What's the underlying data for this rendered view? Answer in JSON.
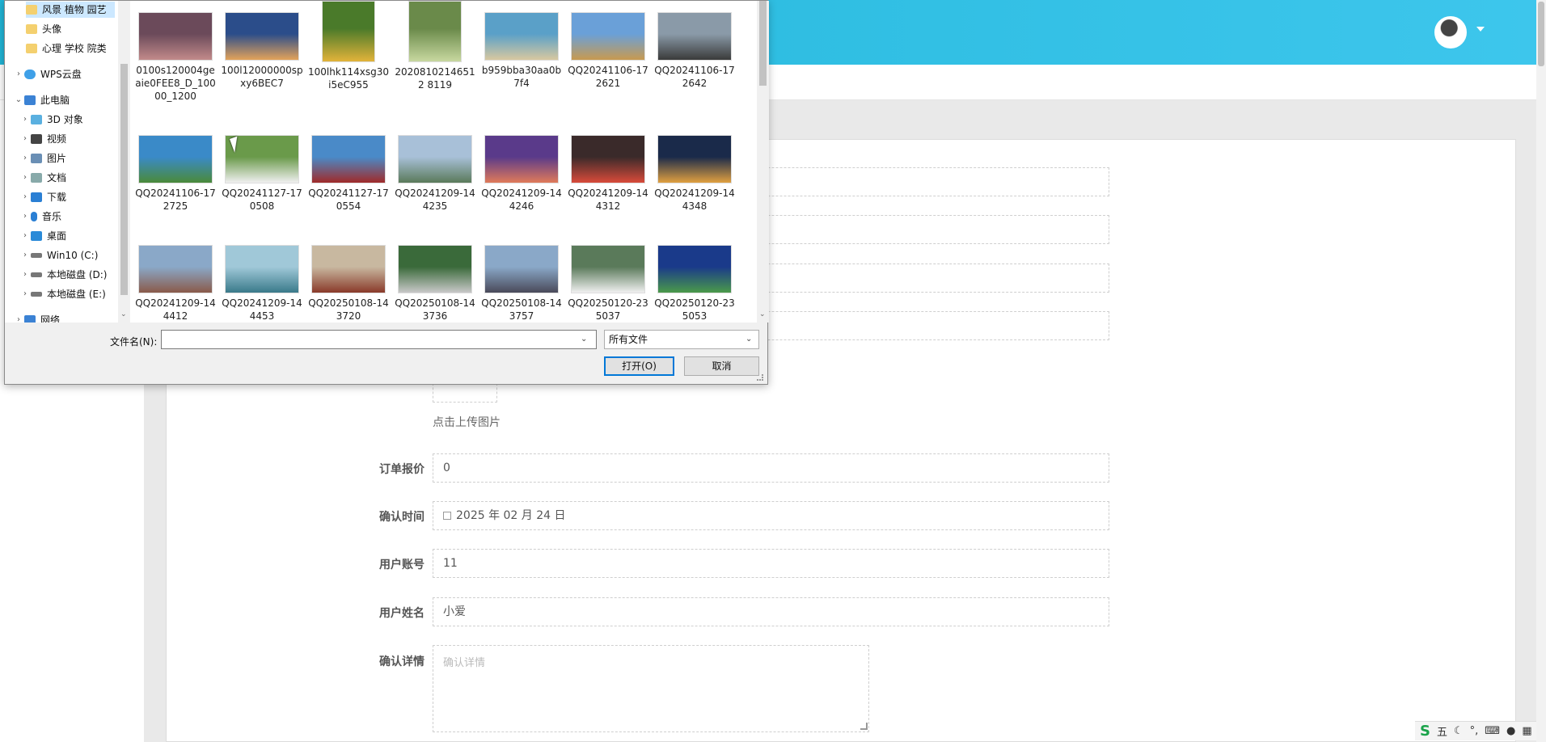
{
  "dialog": {
    "nav_items": [
      {
        "label": "风景 植物 园艺",
        "icon": "folder-icon",
        "selected": true
      },
      {
        "label": "头像",
        "icon": "folder-icon"
      },
      {
        "label": "心理 学校 院类",
        "icon": "folder-icon"
      },
      {
        "label": "WPS云盘",
        "icon": "cloud-icon"
      },
      {
        "label": "此电脑",
        "icon": "computer-icon",
        "expanded": true
      },
      {
        "label": "3D 对象",
        "icon": "cube-icon"
      },
      {
        "label": "视频",
        "icon": "video-icon"
      },
      {
        "label": "图片",
        "icon": "pictures-icon"
      },
      {
        "label": "文档",
        "icon": "documents-icon"
      },
      {
        "label": "下载",
        "icon": "download-icon"
      },
      {
        "label": "音乐",
        "icon": "music-icon"
      },
      {
        "label": "桌面",
        "icon": "desktop-icon"
      },
      {
        "label": "Win10 (C:)",
        "icon": "drive-icon"
      },
      {
        "label": "本地磁盘 (D:)",
        "icon": "drive-icon"
      },
      {
        "label": "本地磁盘 (E:)",
        "icon": "drive-icon"
      },
      {
        "label": "网络",
        "icon": "network-icon"
      }
    ],
    "files": [
      {
        "name": "0100s120004geaie0FEE8_D_10000_1200",
        "colors": [
          "#6b4a5a",
          "#c28a8a"
        ]
      },
      {
        "name": "100l12000000spxy6BEC7",
        "colors": [
          "#2b4d8a",
          "#e3a35a"
        ]
      },
      {
        "name": "100lhk114xsg30i5eC955",
        "colors": [
          "#4a7a2a",
          "#e2b33a"
        ],
        "tall": true
      },
      {
        "name": "20208102146512 8119",
        "colors": [
          "#6a8a4a",
          "#c8d8a0"
        ],
        "tall": true
      },
      {
        "name": "b959bba30aa0b7f4",
        "colors": [
          "#5aa0c8",
          "#d8c8a0"
        ]
      },
      {
        "name": "QQ20241106-172621",
        "colors": [
          "#6aa0d8",
          "#c89a50"
        ]
      },
      {
        "name": "QQ20241106-172642",
        "colors": [
          "#8a9aa8",
          "#3a3a3a"
        ]
      },
      {
        "name": "QQ20241106-172725",
        "colors": [
          "#3a8ac8",
          "#4a8a3a"
        ]
      },
      {
        "name": "QQ20241127-170508",
        "colors": [
          "#6a9a4a",
          "#f0f0f0"
        ]
      },
      {
        "name": "QQ20241127-170554",
        "colors": [
          "#4a8ac8",
          "#a02a2a"
        ]
      },
      {
        "name": "QQ20241209-144235",
        "colors": [
          "#a8c0d8",
          "#5a7a5a"
        ]
      },
      {
        "name": "QQ20241209-144246",
        "colors": [
          "#5a3a8a",
          "#e07a5a"
        ]
      },
      {
        "name": "QQ20241209-144312",
        "colors": [
          "#3a2a2a",
          "#d84a3a"
        ]
      },
      {
        "name": "QQ20241209-144348",
        "colors": [
          "#1a2a4a",
          "#e0a040"
        ]
      },
      {
        "name": "QQ20241209-144412",
        "colors": [
          "#8aa8c8",
          "#8a5a4a"
        ]
      },
      {
        "name": "QQ20241209-144453",
        "colors": [
          "#a0c8d8",
          "#3a7a8a"
        ]
      },
      {
        "name": "QQ20250108-143720",
        "colors": [
          "#c8b8a0",
          "#8a3a2a"
        ]
      },
      {
        "name": "QQ20250108-143736",
        "colors": [
          "#3a6a3a",
          "#c8c8c8"
        ]
      },
      {
        "name": "QQ20250108-143757",
        "colors": [
          "#8aa8c8",
          "#4a4a5a"
        ]
      },
      {
        "name": "QQ20250120-235037",
        "colors": [
          "#5a7a5a",
          "#f0f0f0"
        ]
      },
      {
        "name": "QQ20250120-235053",
        "colors": [
          "#1a3a8a",
          "#4a9a4a"
        ]
      }
    ],
    "filename_label": "文件名(N):",
    "filename_value": "",
    "filter_value": "所有文件",
    "open_label": "打开(O)",
    "cancel_label": "取消"
  },
  "form": {
    "upload_hint": "点击上传图片",
    "fields": [
      {
        "label": "订单报价",
        "value": "0",
        "top": 0
      },
      {
        "label": "确认时间",
        "value": "2025 年 02 月 24 日",
        "calendar": true
      },
      {
        "label": "用户账号",
        "value": "11"
      },
      {
        "label": "用户姓名",
        "value": "小爱"
      }
    ],
    "details_label": "确认详情",
    "details_placeholder": "确认详情"
  },
  "tray": {
    "ime_mode": "五"
  },
  "colors": {
    "header": "#2ebde3",
    "accent": "#0078d7"
  }
}
